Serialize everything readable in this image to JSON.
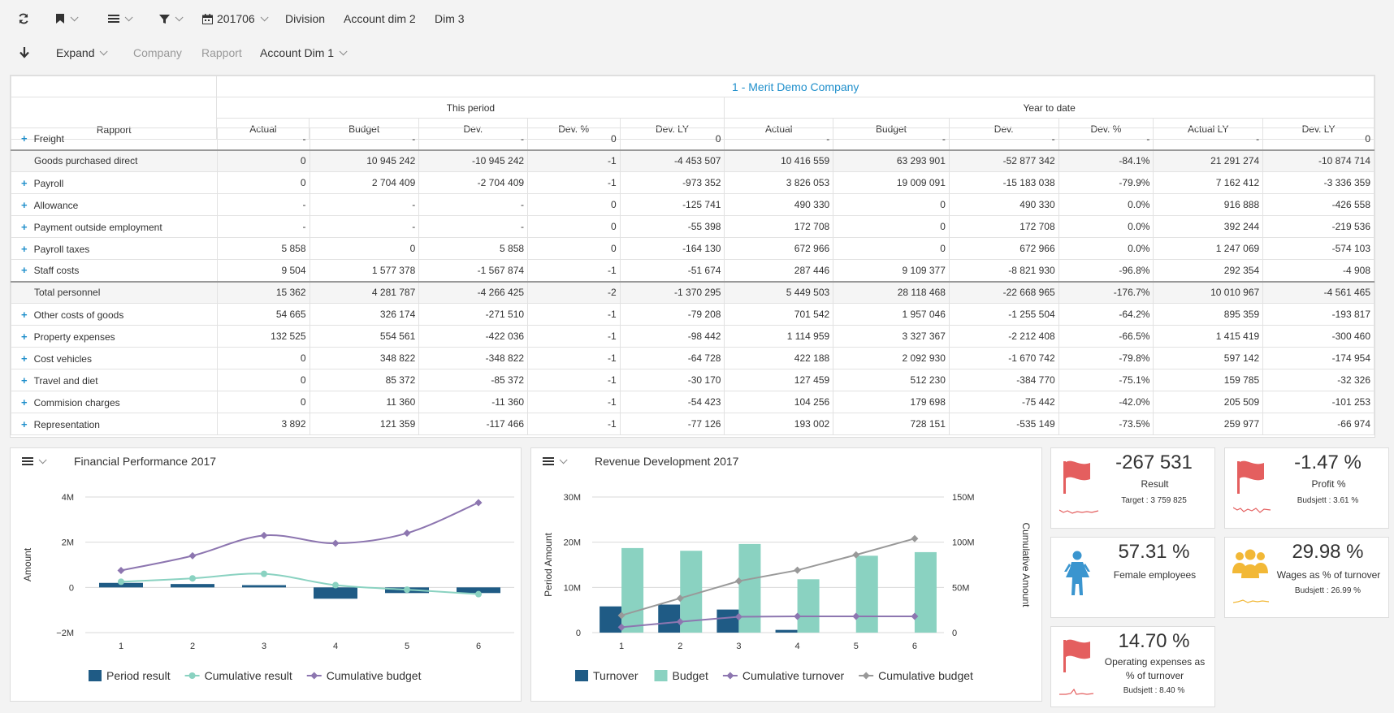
{
  "toolbar": {
    "period": "201706",
    "division": "Division",
    "acc2": "Account dim 2",
    "dim3": "Dim 3",
    "expand": "Expand",
    "company": "Company",
    "rapport": "Rapport",
    "acc1": "Account Dim 1"
  },
  "grid": {
    "company": "1 - Merit Demo Company",
    "this_period": "This period",
    "ytd": "Year to date",
    "rapport": "Rapport",
    "cols": [
      "Actual",
      "Budget",
      "Dev.",
      "Dev. %",
      "Dev. LY",
      "Actual",
      "Budget",
      "Dev.",
      "Dev. %",
      "Actual LY",
      "Dev. LY"
    ],
    "rows": [
      {
        "label": "Freight",
        "plus": true,
        "sub": false,
        "cells": [
          "-",
          "-",
          "-",
          "0",
          "0",
          "-",
          "-",
          "-",
          "-",
          "-",
          "0"
        ]
      },
      {
        "label": "Goods purchased direct",
        "plus": false,
        "sub": true,
        "cells": [
          "0",
          "10 945 242",
          "-10 945 242",
          "-1",
          "-4 453 507",
          "10 416 559",
          "63 293 901",
          "-52 877 342",
          "-84.1%",
          "21 291 274",
          "-10 874 714"
        ]
      },
      {
        "label": "Payroll",
        "plus": true,
        "sub": false,
        "cells": [
          "0",
          "2 704 409",
          "-2 704 409",
          "-1",
          "-973 352",
          "3 826 053",
          "19 009 091",
          "-15 183 038",
          "-79.9%",
          "7 162 412",
          "-3 336 359"
        ]
      },
      {
        "label": "Allowance",
        "plus": true,
        "sub": false,
        "cells": [
          "-",
          "-",
          "-",
          "0",
          "-125 741",
          "490 330",
          "0",
          "490 330",
          "0.0%",
          "916 888",
          "-426 558"
        ]
      },
      {
        "label": "Payment outside employment",
        "plus": true,
        "sub": false,
        "cells": [
          "-",
          "-",
          "-",
          "0",
          "-55 398",
          "172 708",
          "0",
          "172 708",
          "0.0%",
          "392 244",
          "-219 536"
        ]
      },
      {
        "label": "Payroll taxes",
        "plus": true,
        "sub": false,
        "cells": [
          "5 858",
          "0",
          "5 858",
          "0",
          "-164 130",
          "672 966",
          "0",
          "672 966",
          "0.0%",
          "1 247 069",
          "-574 103"
        ]
      },
      {
        "label": "Staff costs",
        "plus": true,
        "sub": false,
        "cells": [
          "9 504",
          "1 577 378",
          "-1 567 874",
          "-1",
          "-51 674",
          "287 446",
          "9 109 377",
          "-8 821 930",
          "-96.8%",
          "292 354",
          "-4 908"
        ]
      },
      {
        "label": "Total personnel",
        "plus": false,
        "sub": true,
        "cells": [
          "15 362",
          "4 281 787",
          "-4 266 425",
          "-2",
          "-1 370 295",
          "5 449 503",
          "28 118 468",
          "-22 668 965",
          "-176.7%",
          "10 010 967",
          "-4 561 465"
        ]
      },
      {
        "label": "Other costs of goods",
        "plus": true,
        "sub": false,
        "cells": [
          "54 665",
          "326 174",
          "-271 510",
          "-1",
          "-79 208",
          "701 542",
          "1 957 046",
          "-1 255 504",
          "-64.2%",
          "895 359",
          "-193 817"
        ]
      },
      {
        "label": "Property expenses",
        "plus": true,
        "sub": false,
        "cells": [
          "132 525",
          "554 561",
          "-422 036",
          "-1",
          "-98 442",
          "1 114 959",
          "3 327 367",
          "-2 212 408",
          "-66.5%",
          "1 415 419",
          "-300 460"
        ]
      },
      {
        "label": "Cost vehicles",
        "plus": true,
        "sub": false,
        "cells": [
          "0",
          "348 822",
          "-348 822",
          "-1",
          "-64 728",
          "422 188",
          "2 092 930",
          "-1 670 742",
          "-79.8%",
          "597 142",
          "-174 954"
        ]
      },
      {
        "label": "Travel and diet",
        "plus": true,
        "sub": false,
        "cells": [
          "0",
          "85 372",
          "-85 372",
          "-1",
          "-30 170",
          "127 459",
          "512 230",
          "-384 770",
          "-75.1%",
          "159 785",
          "-32 326"
        ]
      },
      {
        "label": "Commision charges",
        "plus": true,
        "sub": false,
        "cells": [
          "0",
          "11 360",
          "-11 360",
          "-1",
          "-54 423",
          "104 256",
          "179 698",
          "-75 442",
          "-42.0%",
          "205 509",
          "-101 253"
        ]
      },
      {
        "label": "Representation",
        "plus": true,
        "sub": false,
        "cells": [
          "3 892",
          "121 359",
          "-117 466",
          "-1",
          "-77 126",
          "193 002",
          "728 151",
          "-535 149",
          "-73.5%",
          "259 977",
          "-66 974"
        ]
      }
    ]
  },
  "chart_data": [
    {
      "type": "bar",
      "title": "Financial Performance 2017",
      "ylabel": "Amount",
      "xlabel": "",
      "ylim": [
        -2,
        4
      ],
      "yticks": [
        "−2M",
        "0",
        "2M",
        "4M"
      ],
      "categories": [
        "1",
        "2",
        "3",
        "4",
        "5",
        "6"
      ],
      "series": [
        {
          "name": "Period result",
          "kind": "bar",
          "color": "#1f5b85",
          "values": [
            0.2,
            0.15,
            0.1,
            -0.5,
            -0.25,
            -0.25
          ]
        },
        {
          "name": "Cumulative result",
          "kind": "line",
          "color": "#8ad2c1",
          "values": [
            0.25,
            0.4,
            0.6,
            0.1,
            -0.1,
            -0.3
          ]
        },
        {
          "name": "Cumulative budget",
          "kind": "line",
          "color": "#8d76b0",
          "values": [
            0.75,
            1.4,
            2.3,
            1.95,
            2.4,
            3.75
          ]
        }
      ]
    },
    {
      "type": "bar",
      "title": "Revenue Development 2017",
      "ylabel": "Period Amount",
      "y2label": "Cumulative Amount",
      "xlabel": "",
      "ylim": [
        0,
        30
      ],
      "y2lim": [
        0,
        150
      ],
      "yticks": [
        "0",
        "10M",
        "20M",
        "30M"
      ],
      "y2ticks": [
        "0",
        "50M",
        "100M",
        "150M"
      ],
      "categories": [
        "1",
        "2",
        "3",
        "4",
        "5",
        "6"
      ],
      "series": [
        {
          "name": "Turnover",
          "kind": "bar",
          "color": "#1f5b85",
          "values": [
            5.8,
            6.2,
            5.1,
            0.6,
            0,
            0
          ]
        },
        {
          "name": "Budget",
          "kind": "bar",
          "color": "#8ad2c1",
          "values": [
            18.7,
            18.1,
            19.6,
            11.8,
            17,
            17.8
          ]
        },
        {
          "name": "Cumulative turnover",
          "kind": "line",
          "axis": 2,
          "color": "#8d76b0",
          "values": [
            6,
            12,
            17.5,
            18,
            18,
            18
          ]
        },
        {
          "name": "Cumulative budget",
          "kind": "line",
          "axis": 2,
          "color": "#999999",
          "values": [
            19,
            38,
            57,
            69,
            86,
            104
          ]
        }
      ]
    }
  ],
  "kpis": {
    "result": {
      "value": "-267 531",
      "label": "Result",
      "sub": "Target : 3 759 825"
    },
    "profit": {
      "value": "-1.47 %",
      "label": "Profit %",
      "sub": "Budsjett : 3.61 %"
    },
    "female": {
      "value": "57.31 %",
      "label": "Female employees"
    },
    "wages": {
      "value": "29.98 %",
      "label": "Wages as % of turnover",
      "sub": "Budsjett : 26.99 %"
    },
    "opex": {
      "value": "14.70 %",
      "label": "Operating expenses as % of turnover",
      "sub": "Budsjett : 8.40 %"
    }
  }
}
